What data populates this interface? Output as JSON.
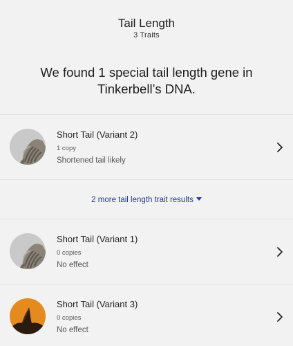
{
  "header": {
    "title": "Tail Length",
    "subtitle": "3 Traits"
  },
  "summary": "We found 1 special tail length gene in Tinkerbell’s DNA.",
  "results": [
    {
      "title": "Short Tail (Variant 2)",
      "copies": "1 copy",
      "effect": "Shortened tail likely",
      "avatar_icon": "cat-tail-photo"
    },
    {
      "title": "Short Tail (Variant 1)",
      "copies": "0 copies",
      "effect": "No effect",
      "avatar_icon": "cat-tail-photo"
    },
    {
      "title": "Short Tail (Variant 3)",
      "copies": "0 copies",
      "effect": "No effect",
      "avatar_icon": "dog-tail-photo"
    }
  ],
  "more_link": {
    "label": "2 more tail length trait results"
  },
  "colors": {
    "background": "#f2f2f2",
    "link": "#233a8c",
    "divider": "#e2e2e2",
    "orange_avatar": "#e58a1f"
  }
}
